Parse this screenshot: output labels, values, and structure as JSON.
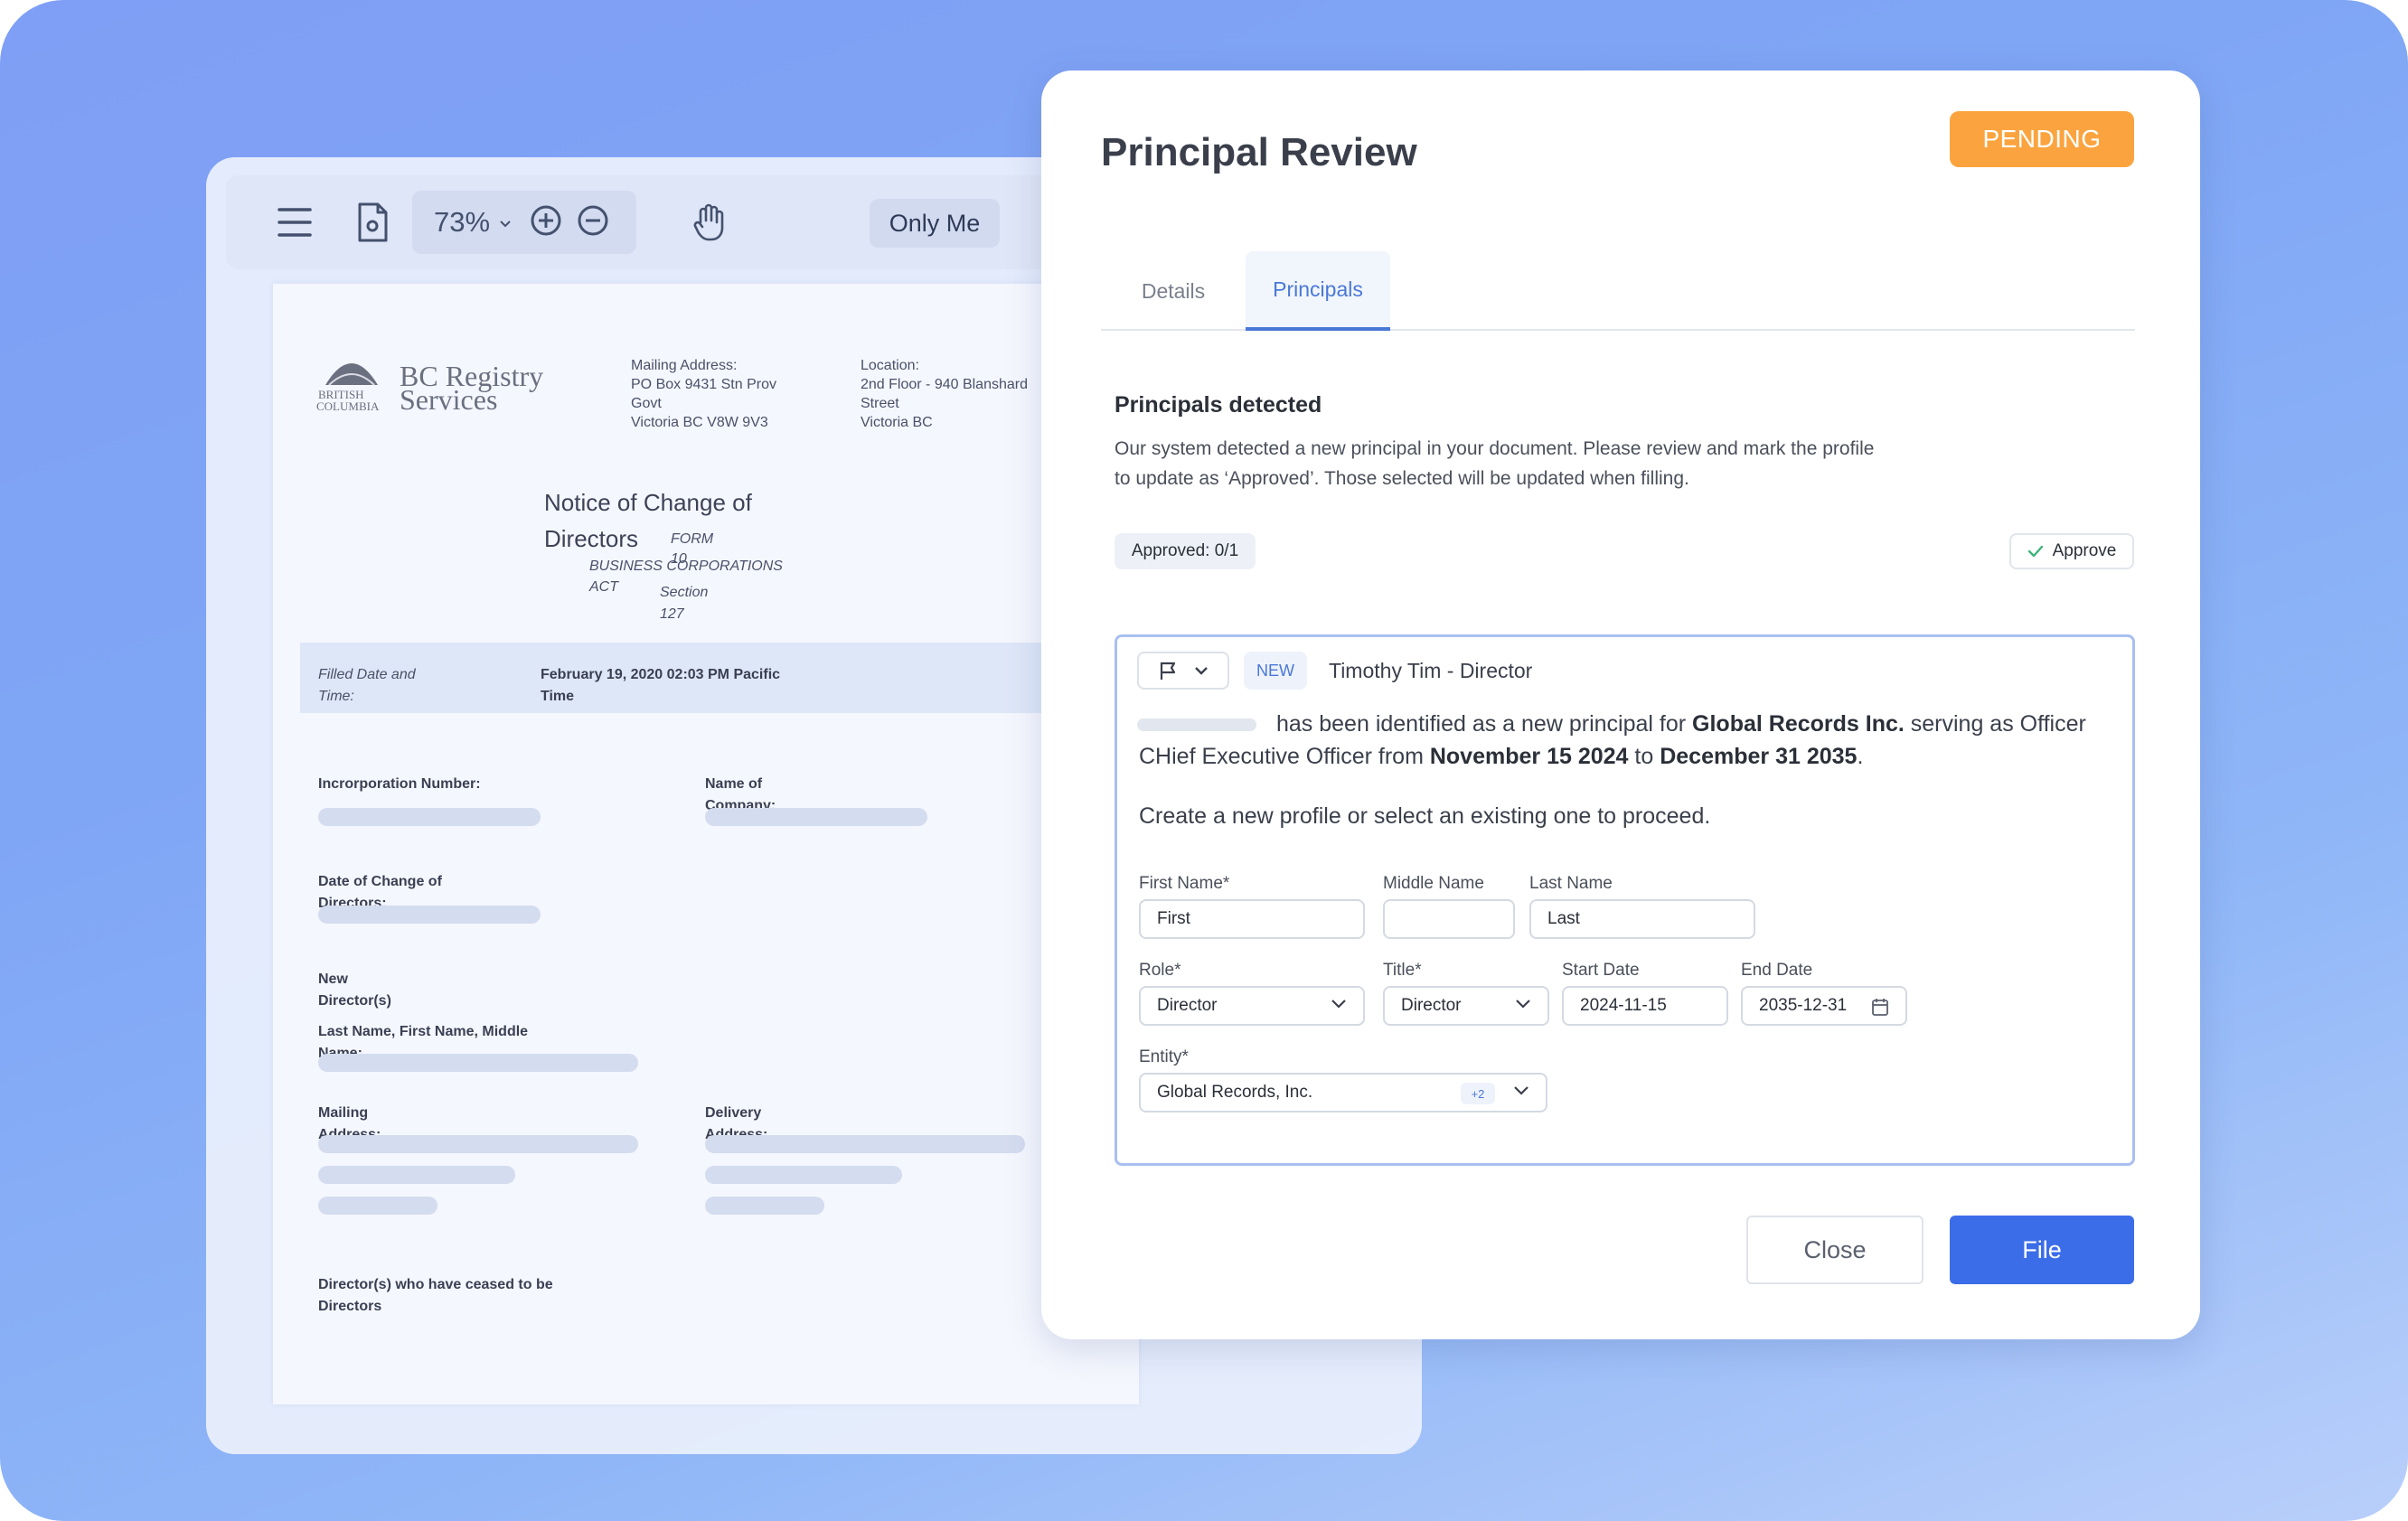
{
  "viewer": {
    "zoom": "73%",
    "visibility_label": "Only Me",
    "icons": [
      "menu-icon",
      "document-settings-icon",
      "chevron-down-icon",
      "zoom-in-icon",
      "zoom-out-icon",
      "hand-icon"
    ]
  },
  "document": {
    "logo_line1": "BC Registry",
    "logo_line2": "Services",
    "logo_bc1": "BRITISH",
    "logo_bc2": "COLUMBIA",
    "mailing_label": "Mailing Address:",
    "mailing_lines": [
      "PO Box 9431 Stn Prov",
      "Govt",
      "Victoria BC V8W 9V3"
    ],
    "location_label": "Location:",
    "location_lines": [
      "2nd Floor - 940 Blanshard",
      "Street",
      "Victoria BC"
    ],
    "title_line1": "Notice of Change of",
    "title_line2": "Directors",
    "form_label": "FORM",
    "form_number": "10",
    "act_line1": "BUSINESS CORPORATIONS",
    "act_line2": "ACT",
    "section_label": "Section",
    "section_number": "127",
    "filed_label_1": "Filled Date and",
    "filed_label_2": "Time:",
    "filed_value_1": "February 19, 2020 02:03 PM Pacific",
    "filed_value_2": "Time",
    "incorporation_label": "Incrorporation Number:",
    "company_label_1": "Name of",
    "company_label_2": "Company:",
    "change_date_label_1": "Date of Change of",
    "change_date_label_2": "Directors:",
    "new_directors_1": "New",
    "new_directors_2": "Director(s)",
    "name_order_1": "Last Name, First Name, Middle",
    "name_order_2": "Name:",
    "mailing_addr_1": "Mailing",
    "mailing_addr_2": "Address:",
    "delivery_addr_1": "Delivery",
    "delivery_addr_2": "Address:",
    "ceased_1": "Director(s) who have ceased to be",
    "ceased_2": "Directors"
  },
  "modal": {
    "title": "Principal Review",
    "status": "PENDING",
    "status_color": "#fba43f",
    "tabs": [
      {
        "label": "Details",
        "active": false
      },
      {
        "label": "Principals",
        "active": true
      }
    ],
    "section_heading": "Principals detected",
    "section_desc_1": "Our system detected a new principal in your document. Please review and mark the profile",
    "section_desc_2": "to update as ‘Approved’. Those selected will be updated when filling.",
    "approved_count": "Approved: 0/1",
    "approve_label": "Approve",
    "card": {
      "badge": "NEW",
      "person": "Timothy Tim - Director",
      "s_pre": "has been identified as a new principal for",
      "s_company": "Global Records Inc.",
      "s_mid": "serving as Officer CHief Executive Officer from",
      "s_start": "November 15 2024",
      "s_to": "to",
      "s_end": "December 31 2035",
      "s_dot": ".",
      "prompt": "Create a new profile or select an existing one to proceed.",
      "first_name_label": "First Name*",
      "first_name_value": "First",
      "middle_name_label": "Middle Name",
      "middle_name_value": "",
      "last_name_label": "Last Name",
      "last_name_value": "Last",
      "role_label": "Role*",
      "role_value": "Director",
      "title_label": "Title*",
      "title_value": "Director",
      "start_date_label": "Start Date",
      "start_date_value": "2024-11-15",
      "end_date_label": "End Date",
      "end_date_value": "2035-12-31",
      "entity_label": "Entity*",
      "entity_value": "Global Records, Inc.",
      "entity_more": "+2"
    },
    "close_label": "Close",
    "file_label": "File",
    "accent_color": "#3c6de8"
  }
}
